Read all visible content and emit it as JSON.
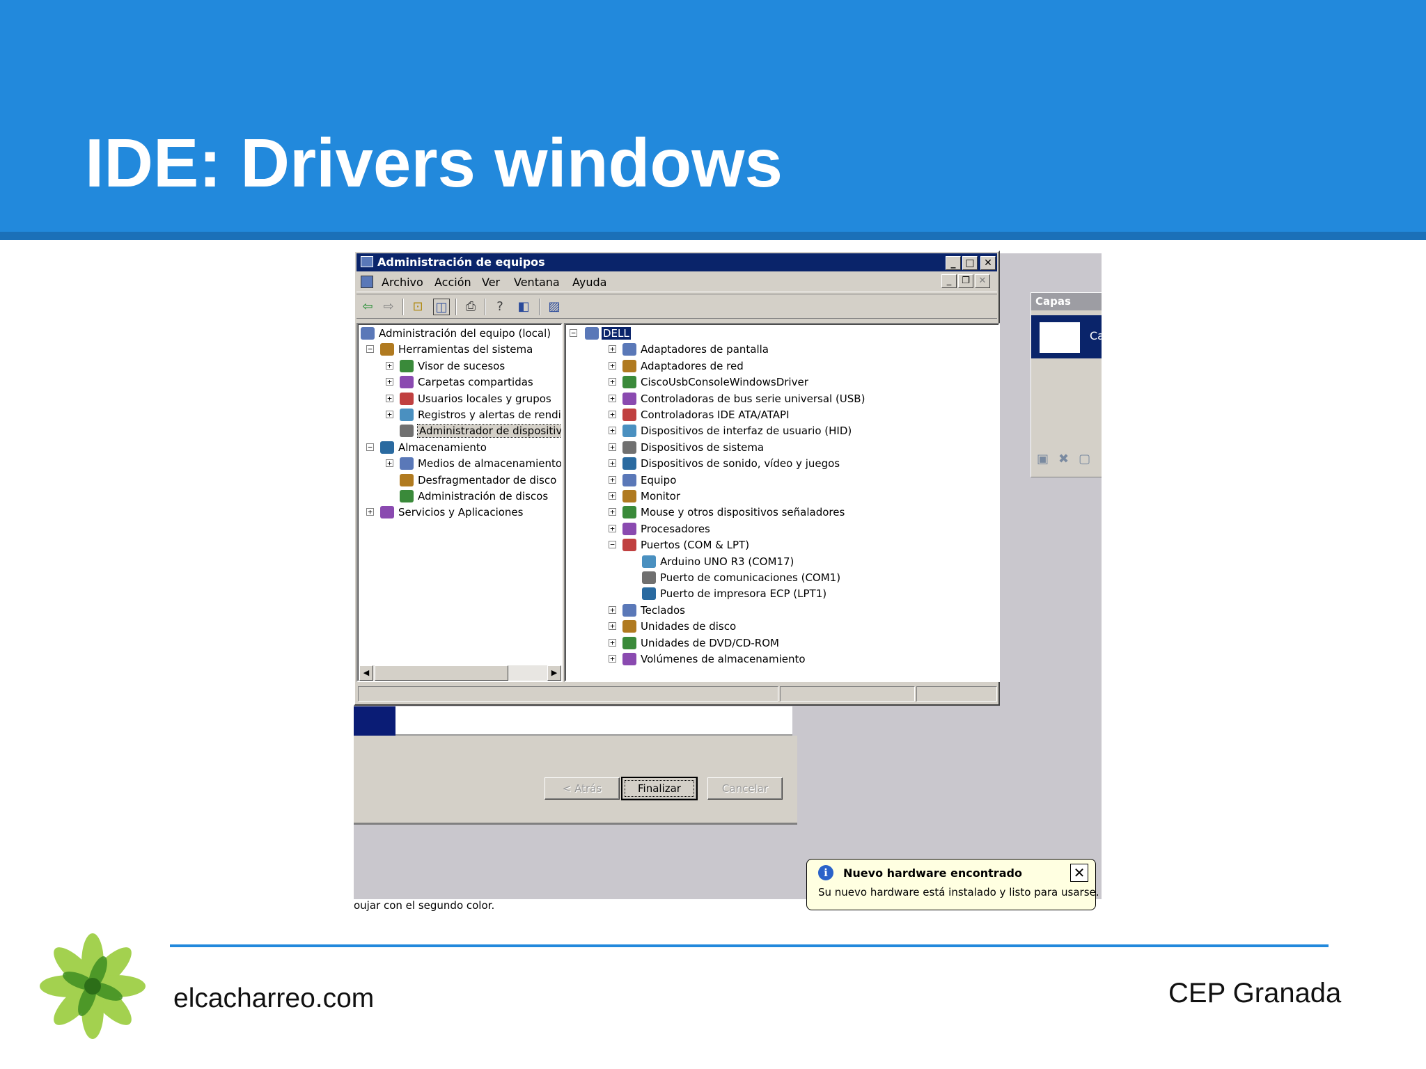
{
  "slide": {
    "title": "IDE: Drivers windows",
    "footer_left": "elcacharreo.com",
    "footer_right": "CEP Granada"
  },
  "colors": {
    "header_blue": "#2289dc",
    "titlebar_blue": "#0a246a",
    "window_gray": "#d4d0c8",
    "balloon_yellow": "#ffffe1"
  },
  "window": {
    "title": "Administración de equipos",
    "menu": [
      "Archivo",
      "Acción",
      "Ver",
      "Ventana",
      "Ayuda"
    ],
    "toolbar_icons": [
      "back-arrow-icon",
      "forward-arrow-icon",
      "up-folder-icon",
      "show-tree-icon",
      "print-icon",
      "help-icon",
      "properties-icon",
      "device-scan-icon"
    ]
  },
  "left_tree": [
    {
      "label": "Administración del equipo (local)",
      "level": 0,
      "expander": ""
    },
    {
      "label": "Herramientas del sistema",
      "level": 1,
      "expander": "-"
    },
    {
      "label": "Visor de sucesos",
      "level": 2,
      "expander": "+"
    },
    {
      "label": "Carpetas compartidas",
      "level": 2,
      "expander": "+"
    },
    {
      "label": "Usuarios locales y grupos",
      "level": 2,
      "expander": "+"
    },
    {
      "label": "Registros y alertas de rendir",
      "level": 2,
      "expander": "+"
    },
    {
      "label": "Administrador de dispositivo",
      "level": 2,
      "expander": "",
      "selected": true
    },
    {
      "label": "Almacenamiento",
      "level": 1,
      "expander": "-"
    },
    {
      "label": "Medios de almacenamiento e",
      "level": 2,
      "expander": "+"
    },
    {
      "label": "Desfragmentador de disco",
      "level": 2,
      "expander": ""
    },
    {
      "label": "Administración de discos",
      "level": 2,
      "expander": ""
    },
    {
      "label": "Servicios y Aplicaciones",
      "level": 1,
      "expander": "+"
    }
  ],
  "device_tree": {
    "root": "DELL",
    "items": [
      {
        "label": "Adaptadores de pantalla",
        "level": 1,
        "expander": "+"
      },
      {
        "label": "Adaptadores de red",
        "level": 1,
        "expander": "+"
      },
      {
        "label": "CiscoUsbConsoleWindowsDriver",
        "level": 1,
        "expander": "+"
      },
      {
        "label": "Controladoras de bus serie universal (USB)",
        "level": 1,
        "expander": "+"
      },
      {
        "label": "Controladoras IDE ATA/ATAPI",
        "level": 1,
        "expander": "+"
      },
      {
        "label": "Dispositivos de interfaz de usuario (HID)",
        "level": 1,
        "expander": "+"
      },
      {
        "label": "Dispositivos de sistema",
        "level": 1,
        "expander": "+"
      },
      {
        "label": "Dispositivos de sonido, vídeo y juegos",
        "level": 1,
        "expander": "+"
      },
      {
        "label": "Equipo",
        "level": 1,
        "expander": "+"
      },
      {
        "label": "Monitor",
        "level": 1,
        "expander": "+"
      },
      {
        "label": "Mouse y otros dispositivos señaladores",
        "level": 1,
        "expander": "+"
      },
      {
        "label": "Procesadores",
        "level": 1,
        "expander": "+"
      },
      {
        "label": "Puertos (COM & LPT)",
        "level": 1,
        "expander": "-"
      },
      {
        "label": "Arduino UNO R3 (COM17)",
        "level": 2,
        "expander": ""
      },
      {
        "label": "Puerto de comunicaciones (COM1)",
        "level": 2,
        "expander": ""
      },
      {
        "label": "Puerto de impresora ECP (LPT1)",
        "level": 2,
        "expander": ""
      },
      {
        "label": "Teclados",
        "level": 1,
        "expander": "+"
      },
      {
        "label": "Unidades de disco",
        "level": 1,
        "expander": "+"
      },
      {
        "label": "Unidades de DVD/CD-ROM",
        "level": 1,
        "expander": "+"
      },
      {
        "label": "Volúmenes de almacenamiento",
        "level": 1,
        "expander": "+"
      }
    ]
  },
  "wizard": {
    "back_label": "< Atrás",
    "finish_label": "Finalizar",
    "cancel_label": "Cancelar"
  },
  "capas": {
    "title": "Capas",
    "item_label": "Ca"
  },
  "balloon": {
    "title": "Nuevo hardware encontrado",
    "message": "Su nuevo hardware está instalado y listo para usarse."
  },
  "status_text": "oujar con el segundo color."
}
